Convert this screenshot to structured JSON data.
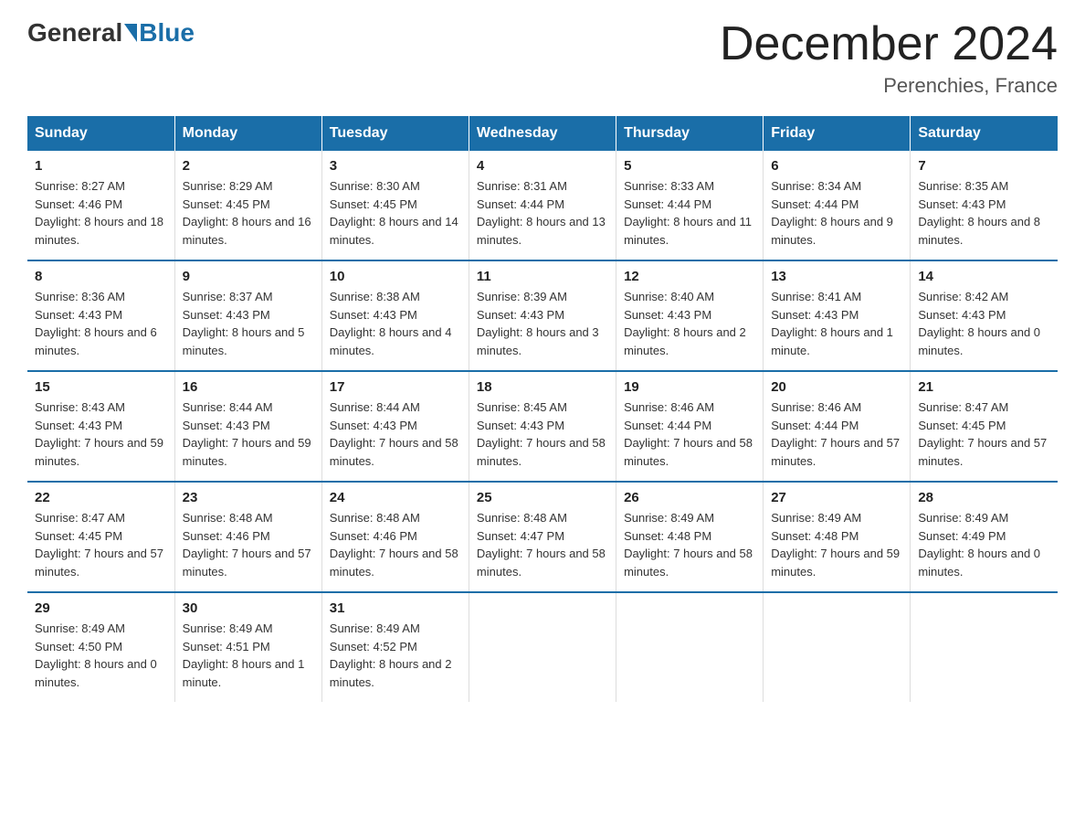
{
  "logo": {
    "general": "General",
    "blue": "Blue"
  },
  "title": "December 2024",
  "subtitle": "Perenchies, France",
  "days_header": [
    "Sunday",
    "Monday",
    "Tuesday",
    "Wednesday",
    "Thursday",
    "Friday",
    "Saturday"
  ],
  "weeks": [
    [
      {
        "day": "1",
        "sunrise": "8:27 AM",
        "sunset": "4:46 PM",
        "daylight": "8 hours and 18 minutes."
      },
      {
        "day": "2",
        "sunrise": "8:29 AM",
        "sunset": "4:45 PM",
        "daylight": "8 hours and 16 minutes."
      },
      {
        "day": "3",
        "sunrise": "8:30 AM",
        "sunset": "4:45 PM",
        "daylight": "8 hours and 14 minutes."
      },
      {
        "day": "4",
        "sunrise": "8:31 AM",
        "sunset": "4:44 PM",
        "daylight": "8 hours and 13 minutes."
      },
      {
        "day": "5",
        "sunrise": "8:33 AM",
        "sunset": "4:44 PM",
        "daylight": "8 hours and 11 minutes."
      },
      {
        "day": "6",
        "sunrise": "8:34 AM",
        "sunset": "4:44 PM",
        "daylight": "8 hours and 9 minutes."
      },
      {
        "day": "7",
        "sunrise": "8:35 AM",
        "sunset": "4:43 PM",
        "daylight": "8 hours and 8 minutes."
      }
    ],
    [
      {
        "day": "8",
        "sunrise": "8:36 AM",
        "sunset": "4:43 PM",
        "daylight": "8 hours and 6 minutes."
      },
      {
        "day": "9",
        "sunrise": "8:37 AM",
        "sunset": "4:43 PM",
        "daylight": "8 hours and 5 minutes."
      },
      {
        "day": "10",
        "sunrise": "8:38 AM",
        "sunset": "4:43 PM",
        "daylight": "8 hours and 4 minutes."
      },
      {
        "day": "11",
        "sunrise": "8:39 AM",
        "sunset": "4:43 PM",
        "daylight": "8 hours and 3 minutes."
      },
      {
        "day": "12",
        "sunrise": "8:40 AM",
        "sunset": "4:43 PM",
        "daylight": "8 hours and 2 minutes."
      },
      {
        "day": "13",
        "sunrise": "8:41 AM",
        "sunset": "4:43 PM",
        "daylight": "8 hours and 1 minute."
      },
      {
        "day": "14",
        "sunrise": "8:42 AM",
        "sunset": "4:43 PM",
        "daylight": "8 hours and 0 minutes."
      }
    ],
    [
      {
        "day": "15",
        "sunrise": "8:43 AM",
        "sunset": "4:43 PM",
        "daylight": "7 hours and 59 minutes."
      },
      {
        "day": "16",
        "sunrise": "8:44 AM",
        "sunset": "4:43 PM",
        "daylight": "7 hours and 59 minutes."
      },
      {
        "day": "17",
        "sunrise": "8:44 AM",
        "sunset": "4:43 PM",
        "daylight": "7 hours and 58 minutes."
      },
      {
        "day": "18",
        "sunrise": "8:45 AM",
        "sunset": "4:43 PM",
        "daylight": "7 hours and 58 minutes."
      },
      {
        "day": "19",
        "sunrise": "8:46 AM",
        "sunset": "4:44 PM",
        "daylight": "7 hours and 58 minutes."
      },
      {
        "day": "20",
        "sunrise": "8:46 AM",
        "sunset": "4:44 PM",
        "daylight": "7 hours and 57 minutes."
      },
      {
        "day": "21",
        "sunrise": "8:47 AM",
        "sunset": "4:45 PM",
        "daylight": "7 hours and 57 minutes."
      }
    ],
    [
      {
        "day": "22",
        "sunrise": "8:47 AM",
        "sunset": "4:45 PM",
        "daylight": "7 hours and 57 minutes."
      },
      {
        "day": "23",
        "sunrise": "8:48 AM",
        "sunset": "4:46 PM",
        "daylight": "7 hours and 57 minutes."
      },
      {
        "day": "24",
        "sunrise": "8:48 AM",
        "sunset": "4:46 PM",
        "daylight": "7 hours and 58 minutes."
      },
      {
        "day": "25",
        "sunrise": "8:48 AM",
        "sunset": "4:47 PM",
        "daylight": "7 hours and 58 minutes."
      },
      {
        "day": "26",
        "sunrise": "8:49 AM",
        "sunset": "4:48 PM",
        "daylight": "7 hours and 58 minutes."
      },
      {
        "day": "27",
        "sunrise": "8:49 AM",
        "sunset": "4:48 PM",
        "daylight": "7 hours and 59 minutes."
      },
      {
        "day": "28",
        "sunrise": "8:49 AM",
        "sunset": "4:49 PM",
        "daylight": "8 hours and 0 minutes."
      }
    ],
    [
      {
        "day": "29",
        "sunrise": "8:49 AM",
        "sunset": "4:50 PM",
        "daylight": "8 hours and 0 minutes."
      },
      {
        "day": "30",
        "sunrise": "8:49 AM",
        "sunset": "4:51 PM",
        "daylight": "8 hours and 1 minute."
      },
      {
        "day": "31",
        "sunrise": "8:49 AM",
        "sunset": "4:52 PM",
        "daylight": "8 hours and 2 minutes."
      },
      null,
      null,
      null,
      null
    ]
  ],
  "labels": {
    "sunrise": "Sunrise:",
    "sunset": "Sunset:",
    "daylight": "Daylight:"
  }
}
